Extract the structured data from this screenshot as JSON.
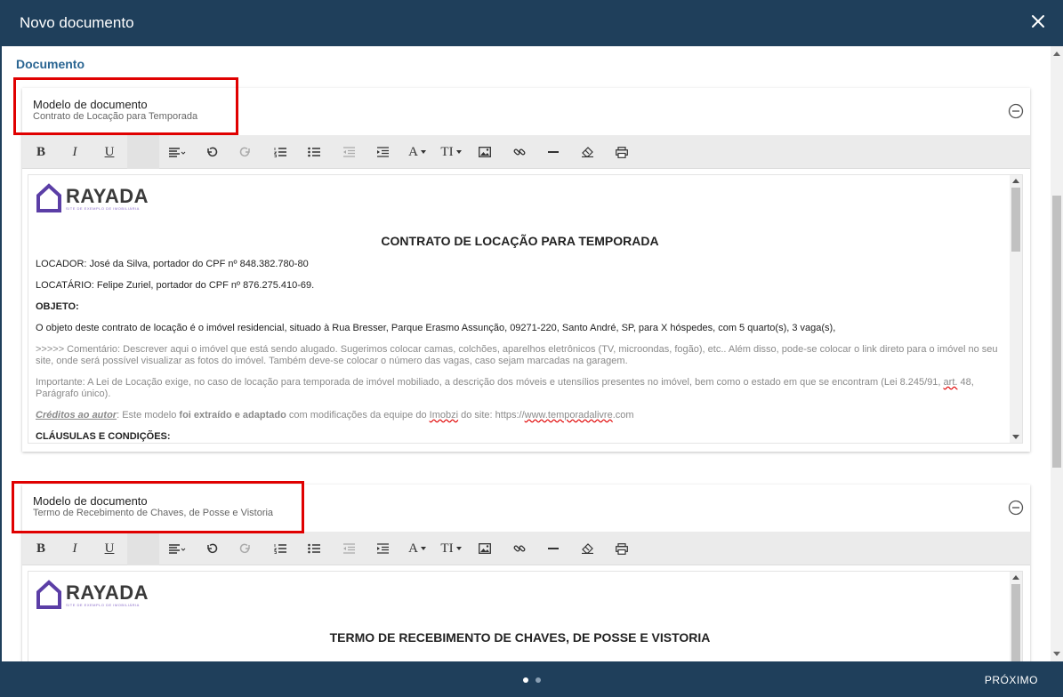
{
  "dialog": {
    "title": "Novo documento",
    "close_icon": "close-icon"
  },
  "section": {
    "title": "Documento"
  },
  "colors": {
    "header_bg": "#1f3f5b",
    "accent_text": "#2a6592",
    "highlight": "#e00000"
  },
  "toolbar": {
    "bold": "B",
    "italic": "I",
    "underline": "U",
    "font_label": "A",
    "size_label": "TI"
  },
  "cards": [
    {
      "label": "Modelo de documento",
      "value": "Contrato de Locação para Temporada",
      "logo": {
        "name": "RAYADA",
        "tagline": "SITE DE EXEMPLO DE IMOBILIÁRIA"
      },
      "doc_title": "CONTRATO DE LOCAÇÃO PARA TEMPORADA",
      "locador": "LOCADOR: José da Silva, portador do CPF nº 848.382.780-80",
      "locatario": "LOCATÁRIO: Felipe Zuriel, portador do CPF nº 876.275.410-69.",
      "objeto_label": "OBJETO:",
      "objeto_text": "O objeto deste contrato de locação é o imóvel residencial, situado à Rua Bresser, Parque Erasmo Assunção, 09271-220, Santo André, SP, para X hóspedes, com 5 quarto(s), 3 vaga(s),",
      "comentario": ">>>>> Comentário: Descrever aqui o imóvel que está sendo alugado. Sugerimos colocar camas, colchões, aparelhos eletrônicos (TV, microondas, fogão), etc.. Além disso, pode-se colocar o link direto para o imóvel no seu site, onde será possível visualizar as fotos do imóvel. Também deve-se colocar o número das vagas, caso sejam marcadas na garagem.",
      "importante_a": "Importante: A Lei de Locação exige, no caso de locação para temporada de imóvel mobiliado, a descrição dos móveis e utensílios presentes no imóvel, bem como o estado em que se encontram (Lei 8.245/91, ",
      "importante_art": "art.",
      "importante_b": " 48, Parágrafo único).",
      "creditos_label": "Créditos ao autor",
      "creditos_a": ": Este modelo ",
      "creditos_bold": "foi extraído e adaptado",
      "creditos_b": " com modificações da equipe do ",
      "creditos_imobzi": "Imobzi",
      "creditos_c": " do site: https://",
      "creditos_url": "www.temporadalivre",
      "creditos_d": ".com",
      "clausulas": "CLÁUSULAS E CONDIÇÕES:"
    },
    {
      "label": "Modelo de documento",
      "value": "Termo de Recebimento de Chaves, de Posse e Vistoria",
      "logo": {
        "name": "RAYADA",
        "tagline": "SITE DE EXEMPLO DE IMOBILIÁRIA"
      },
      "doc_title": "TERMO DE RECEBIMENTO DE CHAVES, DE POSSE E VISTORIA"
    }
  ],
  "footer": {
    "next_label": "PRÓXIMO",
    "page_count": 2,
    "current_page": 1
  }
}
